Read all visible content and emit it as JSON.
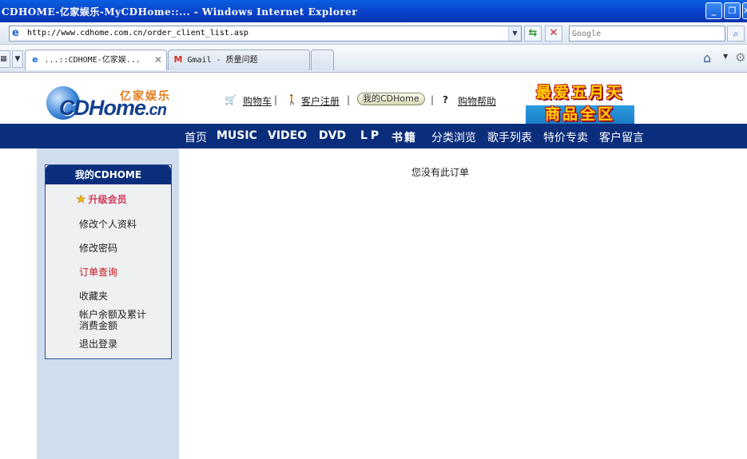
{
  "window": {
    "title": "CDHOME-亿家娱乐-MyCDHome::... - Windows Internet Explorer",
    "minimize_glyph": "_",
    "restore_glyph": "❐",
    "close_glyph": "✕"
  },
  "addressbar": {
    "url": "http://www.cdhome.com.cn/order_client_list.asp",
    "search_placeholder": "Google"
  },
  "tabs": [
    {
      "label": "...::CDHOME-亿家娱...",
      "icon": "ie-icon",
      "active": true
    },
    {
      "label": "Gmail - 质量问题",
      "icon": "gmail-icon",
      "active": false
    }
  ],
  "site": {
    "logo": {
      "cn_name": "亿家娱乐",
      "brand": "CDHome",
      "brand_suffix": ".cn"
    },
    "topnav": {
      "cart": "购物车",
      "register": "客户注册",
      "mycdhome": "我的CDHome",
      "help": "购物帮助",
      "sep": "|"
    },
    "banner": {
      "line1": "最爱五月天",
      "line2": "商品全区"
    },
    "mainnav": [
      "首页",
      "MUSIC",
      "VIDEO",
      "DVD",
      "LP",
      "书籍",
      "分类浏览",
      "歌手列表",
      "特价专卖",
      "客户留言"
    ]
  },
  "sidebar": {
    "title": "我的CDHOME",
    "upgrade": "升级会员",
    "items": [
      "修改个人资料",
      "修改密码",
      "订单查询",
      "收藏夹",
      "帐户余额及累计",
      "消费金额",
      "退出登录"
    ]
  },
  "main": {
    "message": "您没有此订单"
  },
  "colors": {
    "nav_bg": "#0b2e7c",
    "left_column_bg": "#cfddee",
    "active_link": "#c4161c",
    "upgrade_text": "#d23b5a"
  }
}
